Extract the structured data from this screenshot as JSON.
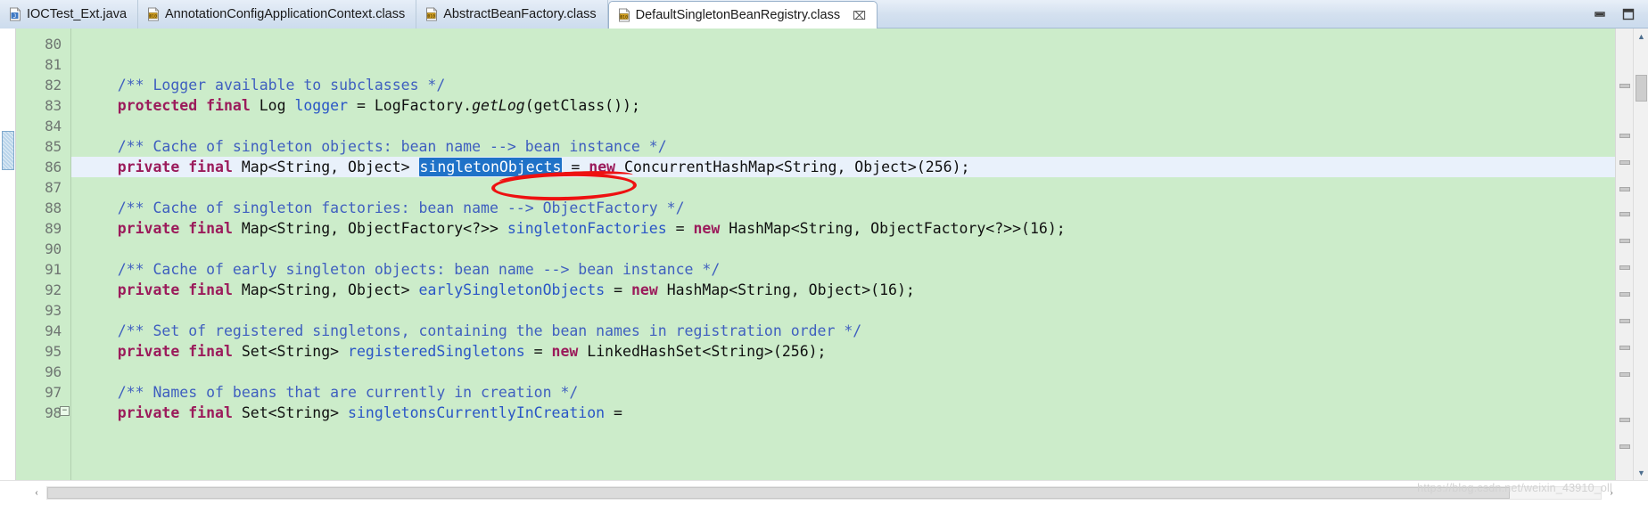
{
  "window": {
    "minimize_label": "Minimize",
    "restore_label": "Restore"
  },
  "tabs": [
    {
      "label": "IOCTest_Ext.java",
      "icon": "java-file-icon",
      "active": false,
      "closable": false
    },
    {
      "label": "AnnotationConfigApplicationContext.class",
      "icon": "class-file-icon",
      "active": false,
      "closable": false
    },
    {
      "label": "AbstractBeanFactory.class",
      "icon": "class-file-icon",
      "active": false,
      "closable": false
    },
    {
      "label": "DefaultSingletonBeanRegistry.class",
      "icon": "class-file-icon",
      "active": true,
      "closable": true,
      "close_glyph": "⌧"
    }
  ],
  "editor": {
    "first_line": 80,
    "current_line": 86,
    "fold_marker_glyph": "−",
    "selection_text": "singletonObjects",
    "annotation": {
      "type": "red-oval",
      "color": "#ee1111",
      "around": "singletonObjects"
    },
    "line_numbers": [
      80,
      81,
      82,
      83,
      84,
      85,
      86,
      87,
      88,
      89,
      90,
      91,
      92,
      93,
      94,
      95,
      96,
      97,
      98
    ],
    "lines": [
      {
        "n": 80,
        "segments": []
      },
      {
        "n": 81,
        "segments": []
      },
      {
        "n": 82,
        "segments": [
          {
            "t": "plain",
            "s": "    "
          },
          {
            "t": "cmt",
            "s": "/** Logger available to subclasses */"
          }
        ]
      },
      {
        "n": 83,
        "segments": [
          {
            "t": "plain",
            "s": "    "
          },
          {
            "t": "kw",
            "s": "protected final"
          },
          {
            "t": "plain",
            "s": " Log "
          },
          {
            "t": "field",
            "s": "logger"
          },
          {
            "t": "plain",
            "s": " = LogFactory."
          },
          {
            "t": "mth-it",
            "s": "getLog"
          },
          {
            "t": "plain",
            "s": "(getClass());"
          }
        ]
      },
      {
        "n": 84,
        "segments": []
      },
      {
        "n": 85,
        "segments": [
          {
            "t": "plain",
            "s": "    "
          },
          {
            "t": "cmt",
            "s": "/** Cache of singleton objects: bean name --> bean instance */"
          }
        ]
      },
      {
        "n": 86,
        "segments": [
          {
            "t": "plain",
            "s": "    "
          },
          {
            "t": "kw",
            "s": "private final"
          },
          {
            "t": "plain",
            "s": " Map<String, Object> "
          },
          {
            "t": "sel",
            "s": "singletonObjects"
          },
          {
            "t": "plain",
            "s": " = "
          },
          {
            "t": "kw",
            "s": "new"
          },
          {
            "t": "plain",
            "s": " ConcurrentHashMap<String, Object>(256);"
          }
        ]
      },
      {
        "n": 87,
        "segments": []
      },
      {
        "n": 88,
        "segments": [
          {
            "t": "plain",
            "s": "    "
          },
          {
            "t": "cmt",
            "s": "/** Cache of singleton factories: bean name --> ObjectFactory */"
          }
        ]
      },
      {
        "n": 89,
        "segments": [
          {
            "t": "plain",
            "s": "    "
          },
          {
            "t": "kw",
            "s": "private final"
          },
          {
            "t": "plain",
            "s": " Map<String, ObjectFactory<?>> "
          },
          {
            "t": "field",
            "s": "singletonFactories"
          },
          {
            "t": "plain",
            "s": " = "
          },
          {
            "t": "kw",
            "s": "new"
          },
          {
            "t": "plain",
            "s": " HashMap<String, ObjectFactory<?>>(16);"
          }
        ]
      },
      {
        "n": 90,
        "segments": []
      },
      {
        "n": 91,
        "segments": [
          {
            "t": "plain",
            "s": "    "
          },
          {
            "t": "cmt",
            "s": "/** Cache of early singleton objects: bean name --> bean instance */"
          }
        ]
      },
      {
        "n": 92,
        "segments": [
          {
            "t": "plain",
            "s": "    "
          },
          {
            "t": "kw",
            "s": "private final"
          },
          {
            "t": "plain",
            "s": " Map<String, Object> "
          },
          {
            "t": "field",
            "s": "earlySingletonObjects"
          },
          {
            "t": "plain",
            "s": " = "
          },
          {
            "t": "kw",
            "s": "new"
          },
          {
            "t": "plain",
            "s": " HashMap<String, Object>(16);"
          }
        ]
      },
      {
        "n": 93,
        "segments": []
      },
      {
        "n": 94,
        "segments": [
          {
            "t": "plain",
            "s": "    "
          },
          {
            "t": "cmt",
            "s": "/** Set of registered singletons, containing the bean names in registration order */"
          }
        ]
      },
      {
        "n": 95,
        "segments": [
          {
            "t": "plain",
            "s": "    "
          },
          {
            "t": "kw",
            "s": "private final"
          },
          {
            "t": "plain",
            "s": " Set<String> "
          },
          {
            "t": "field",
            "s": "registeredSingletons"
          },
          {
            "t": "plain",
            "s": " = "
          },
          {
            "t": "kw",
            "s": "new"
          },
          {
            "t": "plain",
            "s": " LinkedHashSet<String>(256);"
          }
        ]
      },
      {
        "n": 96,
        "segments": []
      },
      {
        "n": 97,
        "segments": [
          {
            "t": "plain",
            "s": "    "
          },
          {
            "t": "cmt",
            "s": "/** Names of beans that are currently in creation */"
          }
        ]
      },
      {
        "n": 98,
        "segments": [
          {
            "t": "plain",
            "s": "    "
          },
          {
            "t": "kw",
            "s": "private final"
          },
          {
            "t": "plain",
            "s": " Set<String> "
          },
          {
            "t": "field",
            "s": "singletonsCurrentlyInCreation"
          },
          {
            "t": "plain",
            "s": " ="
          }
        ]
      }
    ]
  },
  "scrollbars": {
    "vertical_up_glyph": "▲",
    "vertical_down_glyph": "▼",
    "horizontal_left_glyph": "‹",
    "horizontal_right_glyph": "›"
  },
  "watermark": {
    "text": "https://blog.csdn.net/weixin_43910_oll"
  },
  "colors": {
    "editor_background": "#ccecca",
    "current_line": "#e9f1fb",
    "selection": "#1f72c8",
    "comment": "#3f5fbf",
    "keyword": "#9b1b5b",
    "field": "#2a56c6",
    "annotation_red": "#ee1111"
  }
}
